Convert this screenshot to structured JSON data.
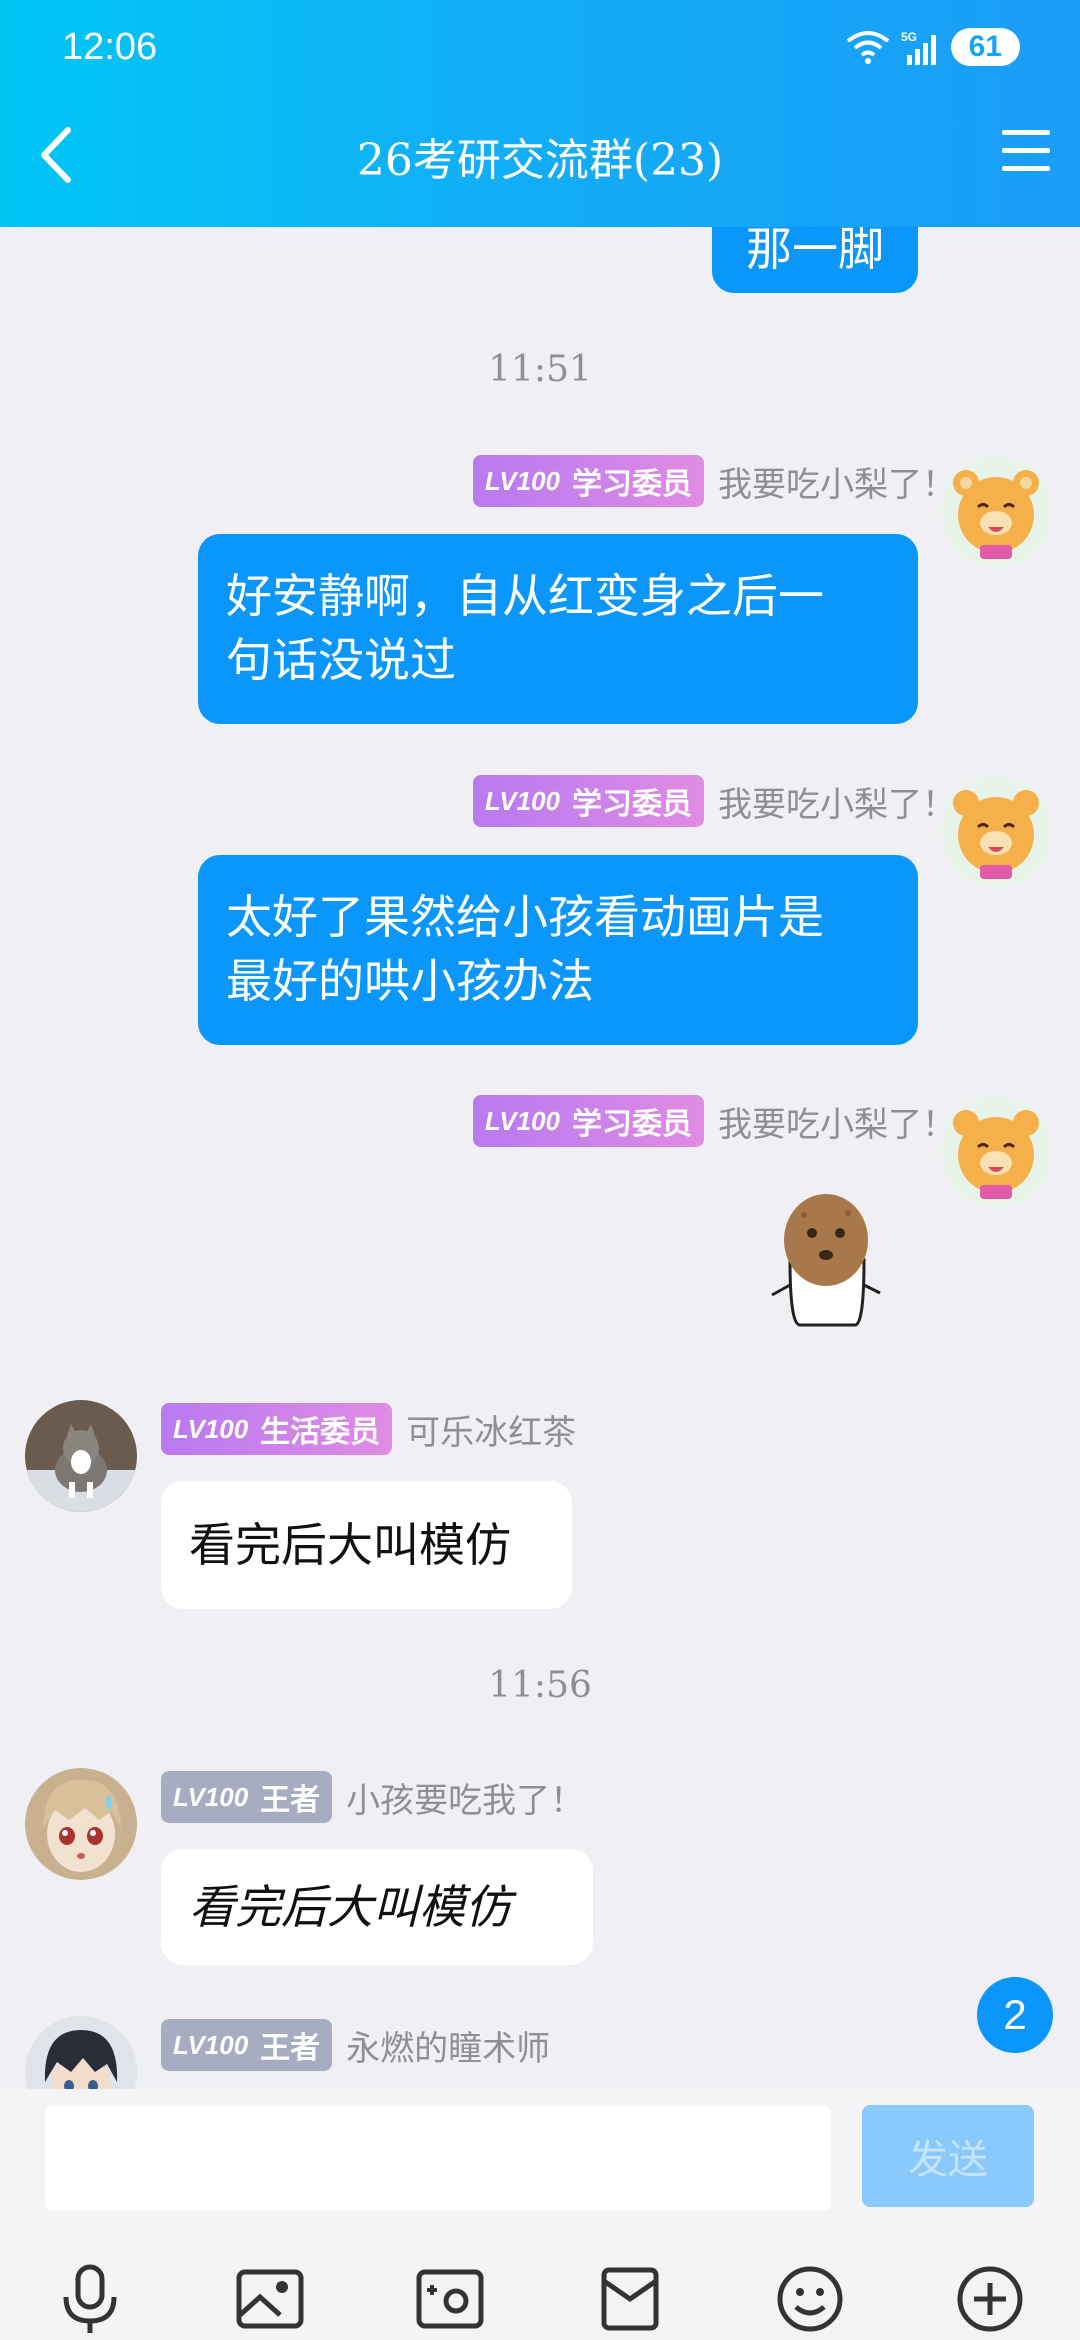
{
  "status": {
    "time": "12:06",
    "network": "5G",
    "battery": "61"
  },
  "header": {
    "title": "26考研交流群(23)"
  },
  "top_bubble_partial": "那一脚",
  "time_separators": [
    "11:51",
    "11:56"
  ],
  "messages": [
    {
      "badge_level": "LV100",
      "badge_title": "学习委员",
      "nickname": "我要吃小梨了！",
      "text_line1": "好安静啊，自从红变身之后一",
      "text_line2": "句话没说过"
    },
    {
      "badge_level": "LV100",
      "badge_title": "学习委员",
      "nickname": "我要吃小梨了！",
      "text_line1": "太好了果然给小孩看动画片是",
      "text_line2": "最好的哄小孩办法"
    },
    {
      "badge_level": "LV100",
      "badge_title": "学习委员",
      "nickname": "我要吃小梨了！",
      "sticker": "potato-ghost-sticker"
    },
    {
      "badge_level": "LV100",
      "badge_title": "生活委员",
      "nickname": "可乐冰红茶",
      "text": "看完后大叫模仿"
    },
    {
      "badge_level": "LV100",
      "badge_title": "王者",
      "nickname": "小孩要吃我了！",
      "text": "看完后大叫模仿"
    },
    {
      "badge_level": "LV100",
      "badge_title": "王者",
      "nickname": "永燃的瞳术师"
    }
  ],
  "unread_count": "2",
  "input": {
    "placeholder": "",
    "send_label": "发送"
  },
  "toolbar": [
    "microphone-icon",
    "image-icon",
    "camera-icon",
    "red-packet-icon",
    "emoji-icon",
    "plus-icon"
  ],
  "colors": {
    "accent": "#0a96fa",
    "header_start": "#00c6f4",
    "header_end": "#1a9df7",
    "badge_purple": "#b879f1",
    "badge_gray": "#a6adc0"
  }
}
